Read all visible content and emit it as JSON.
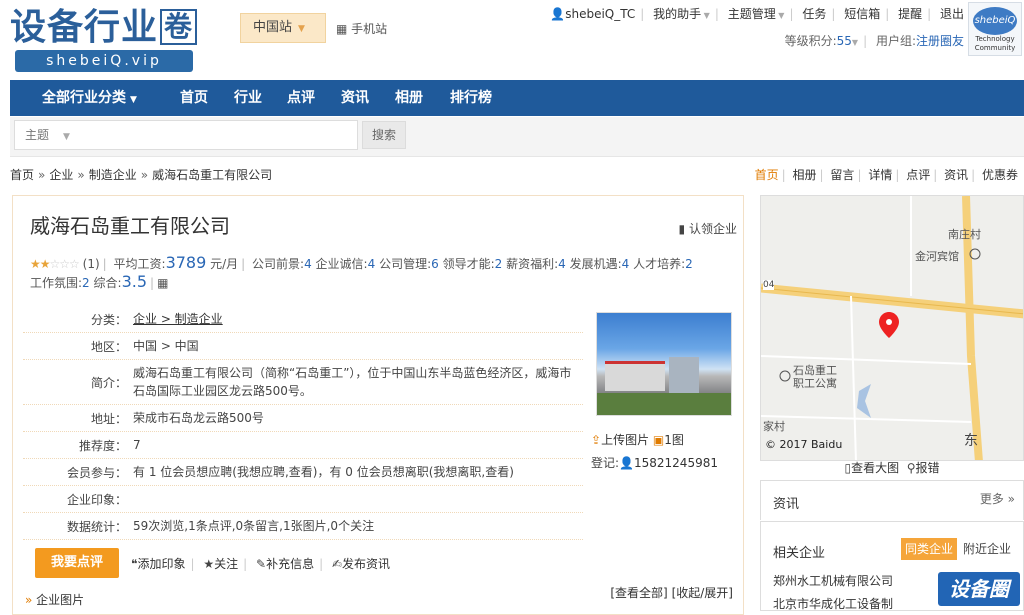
{
  "logo": {
    "title": "设备行业",
    "box": "卷",
    "url": "shebeiQ.vip"
  },
  "station": {
    "label": "中国站",
    "mobile": "手机站"
  },
  "user": {
    "name": "shebeiQ_TC",
    "helper": "我的助手",
    "topic_manage": "主题管理",
    "task": "任务",
    "inbox": "短信箱",
    "remind": "提醒",
    "logout": "退出",
    "points_label": "等级积分:",
    "points": "55",
    "group_label": "用户组:",
    "group": "注册圈友"
  },
  "avatar": {
    "text": "shebeiQ",
    "sub1": "Technology",
    "sub2": "Community"
  },
  "nav": {
    "all": "全部行业分类",
    "items": [
      "首页",
      "行业",
      "点评",
      "资讯",
      "相册",
      "排行榜"
    ]
  },
  "search": {
    "select": "主题",
    "button": "搜索"
  },
  "breadcrumb": [
    "首页",
    "企业",
    "制造企业",
    "威海石岛重工有限公司"
  ],
  "subtabs": [
    "首页",
    "相册",
    "留言",
    "详情",
    "点评",
    "资讯",
    "优惠券"
  ],
  "company": {
    "name": "威海石岛重工有限公司",
    "claim": "认领企业",
    "stars": 2,
    "review_count": "(1)",
    "salary_label": "平均工资:",
    "salary": "3789",
    "salary_unit": "元/月",
    "scores": [
      {
        "label": "公司前景:",
        "value": "4"
      },
      {
        "label": "企业诚信:",
        "value": "4"
      },
      {
        "label": "公司管理:",
        "value": "6"
      },
      {
        "label": "领导才能:",
        "value": "2"
      },
      {
        "label": "薪资福利:",
        "value": "4"
      },
      {
        "label": "发展机遇:",
        "value": "4"
      },
      {
        "label": "人才培养:",
        "value": "2"
      },
      {
        "label": "工作氛围:",
        "value": "2"
      }
    ],
    "overall_label": "综合:",
    "overall": "3.5"
  },
  "info": {
    "category_label": "分类：",
    "category": "企业 > 制造企业",
    "region_label": "地区：",
    "region": "中国 > 中国",
    "intro_label": "简介：",
    "intro": "威海石岛重工有限公司（简称“石岛重工”），位于中国山东半岛蓝色经济区，威海市石岛国际工业园区龙云路500号。",
    "address_label": "地址：",
    "address": "荣成市石岛龙云路500号",
    "recommend_label": "推荐度：",
    "recommend": "7",
    "member_label": "会员参与：",
    "member": "有 1 位会员想应聘(我想应聘,查看)，有 0 位会员想离职(我想离职,查看)",
    "impression_label": "企业印象：",
    "impression": "",
    "stats_label": "数据统计：",
    "stats": "59次浏览,1条点评,0条留言,1张图片,0个关注"
  },
  "photo": {
    "upload": "上传图片",
    "count": "1图",
    "reg_label": "登记:",
    "reg_user": "15821245981"
  },
  "actions": {
    "review": "我要点评",
    "impression": "添加印象",
    "follow": "关注",
    "supplement": "补充信息",
    "publish": "发布资讯"
  },
  "view": {
    "all": "[查看全部]",
    "toggle": "[收起/展开]"
  },
  "company_images": "企业图片",
  "map": {
    "labels": [
      "南庄村",
      "金河宾馆",
      "石岛重工",
      "职工公寓",
      "家村",
      "东",
      "04"
    ],
    "copyright": "© 2017 Baidu",
    "view_large": "查看大图",
    "report": "报错"
  },
  "news": {
    "title": "资讯",
    "more": "更多 »"
  },
  "related": {
    "title": "相关企业",
    "tab_active": "同类企业",
    "tab_other": "附近企业",
    "items": [
      "郑州水工机械有限公司",
      "北京市华成化工设备制"
    ]
  },
  "float_logo": "设备圈"
}
